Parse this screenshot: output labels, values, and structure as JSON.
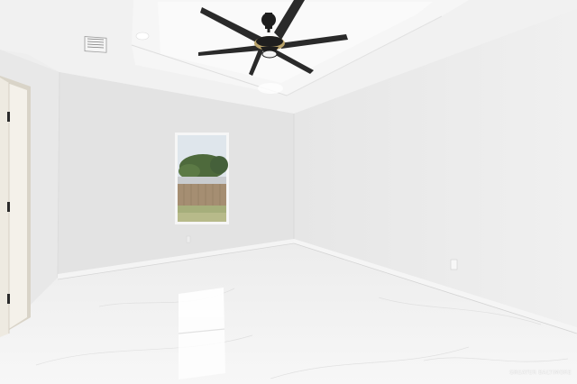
{
  "photo": {
    "watermark_text": "GREATER BALTIMORE",
    "colors": {
      "wall_left": "#e9e9e9",
      "wall_back": "#e4e4e4",
      "wall_right": "#ececec",
      "ceiling": "#f2f2f2",
      "tray_ceiling": "#f8f8f8",
      "floor": "#f3f3f3",
      "fan_body": "#1e1e1e",
      "fan_brass": "#b9a36a",
      "window_sky": "#dfe6ec",
      "window_trees": "#4e6a3c",
      "window_fence": "#a58e72",
      "window_grass": "#a6ae7b",
      "door_trim": "#f4f1ea",
      "door_hinge": "#2b2b2b"
    }
  }
}
